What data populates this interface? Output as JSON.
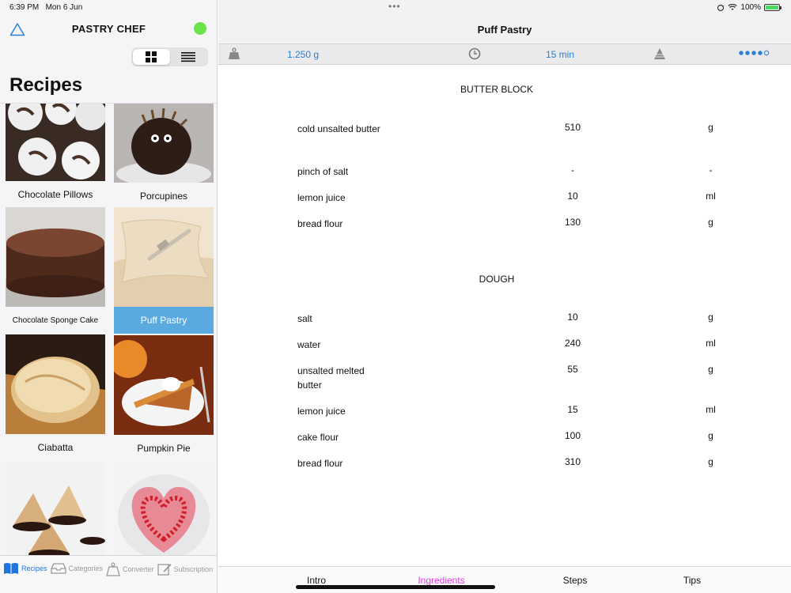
{
  "status_bar": {
    "time": "6:39 PM",
    "date": "Mon 6 Jun",
    "battery": "100%",
    "battery_level": 1.0
  },
  "sidebar": {
    "brand_title": "PASTRY CHEF",
    "status_color": "#6be14a",
    "section_title": "Recipes",
    "recipes": [
      {
        "name": "Chocolate Pillows"
      },
      {
        "name": "Porcupines"
      },
      {
        "name": "Chocolate Sponge Cake"
      },
      {
        "name": "Puff Pastry",
        "selected": true
      },
      {
        "name": "Ciabatta"
      },
      {
        "name": "Pumpkin Pie"
      },
      {
        "name": ""
      },
      {
        "name": ""
      }
    ],
    "tabs": [
      {
        "label": "Recipes",
        "icon": "book-icon",
        "active": true
      },
      {
        "label": "Categories",
        "icon": "tray-icon"
      },
      {
        "label": "Converter",
        "icon": "scale-icon"
      },
      {
        "label": "Subscription",
        "icon": "edit-icon"
      }
    ]
  },
  "detail": {
    "title": "Puff Pastry",
    "weight": "1.250 g",
    "time": "15 min",
    "difficulty_level": 4,
    "difficulty_max": 5,
    "accent_color": "#2b7fd4",
    "sections": [
      {
        "title": "BUTTER BLOCK",
        "items": [
          {
            "name": "cold unsalted butter",
            "qty": "510",
            "unit": "g"
          },
          {
            "name": "pinch of salt",
            "qty": "-",
            "unit": "-"
          },
          {
            "name": "lemon juice",
            "qty": "10",
            "unit": "ml"
          },
          {
            "name": "bread flour",
            "qty": "130",
            "unit": "g"
          }
        ]
      },
      {
        "title": "DOUGH",
        "items": [
          {
            "name": "salt",
            "qty": "10",
            "unit": "g"
          },
          {
            "name": "water",
            "qty": "240",
            "unit": "ml"
          },
          {
            "name": "unsalted melted butter",
            "qty": "55",
            "unit": "g"
          },
          {
            "name": "lemon juice",
            "qty": "15",
            "unit": "ml"
          },
          {
            "name": "cake flour",
            "qty": "100",
            "unit": "g"
          },
          {
            "name": "bread flour",
            "qty": "310",
            "unit": "g"
          }
        ]
      }
    ],
    "tabs": [
      {
        "label": "Intro"
      },
      {
        "label": "Ingredients",
        "active": true
      },
      {
        "label": "Steps"
      },
      {
        "label": "Tips"
      }
    ],
    "active_tab_color": "#e03ee0"
  }
}
